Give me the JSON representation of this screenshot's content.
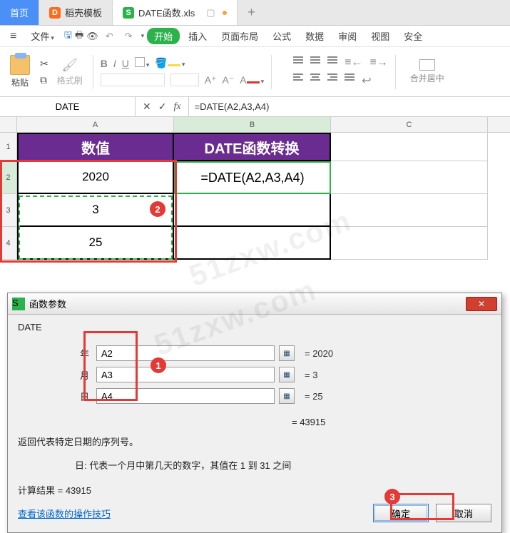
{
  "tabs": {
    "home": "首页",
    "tpl": "稻壳模板",
    "file": "DATE函数.xls"
  },
  "ribbon": {
    "file": "文件",
    "start": "开始",
    "insert": "插入",
    "layout": "页面布局",
    "formula": "公式",
    "data": "数据",
    "review": "审阅",
    "view": "视图",
    "security": "安全",
    "paste": "粘贴",
    "fmtbrush": "格式刷",
    "merge": "合并居中"
  },
  "fxbar": {
    "name": "DATE",
    "formula": "=DATE(A2,A3,A4)"
  },
  "headers": {
    "a": "数值",
    "b": "DATE函数转换"
  },
  "cols": {
    "a": "A",
    "b": "B",
    "c": "C"
  },
  "cells": {
    "a2": "2020",
    "a3": "3",
    "a4": "25",
    "b2": "=DATE(A2,A3,A4)"
  },
  "badges": {
    "b1": "1",
    "b2": "2",
    "b3": "3"
  },
  "dialog": {
    "title": "函数参数",
    "fname": "DATE",
    "args": {
      "year_l": "年",
      "year_v": "A2",
      "year_r": "= 2020",
      "month_l": "月",
      "month_v": "A3",
      "month_r": "= 3",
      "day_l": "日",
      "day_v": "A4",
      "day_r": "= 25"
    },
    "result_inline": "= 43915",
    "desc1": "返回代表特定日期的序列号。",
    "desc2": "日:  代表一个月中第几天的数字，其值在 1 到 31 之间",
    "calc": "计算结果 = 43915",
    "help": "查看该函数的操作技巧",
    "ok": "确定",
    "cancel": "取消"
  },
  "watermark": "51zxw.com"
}
